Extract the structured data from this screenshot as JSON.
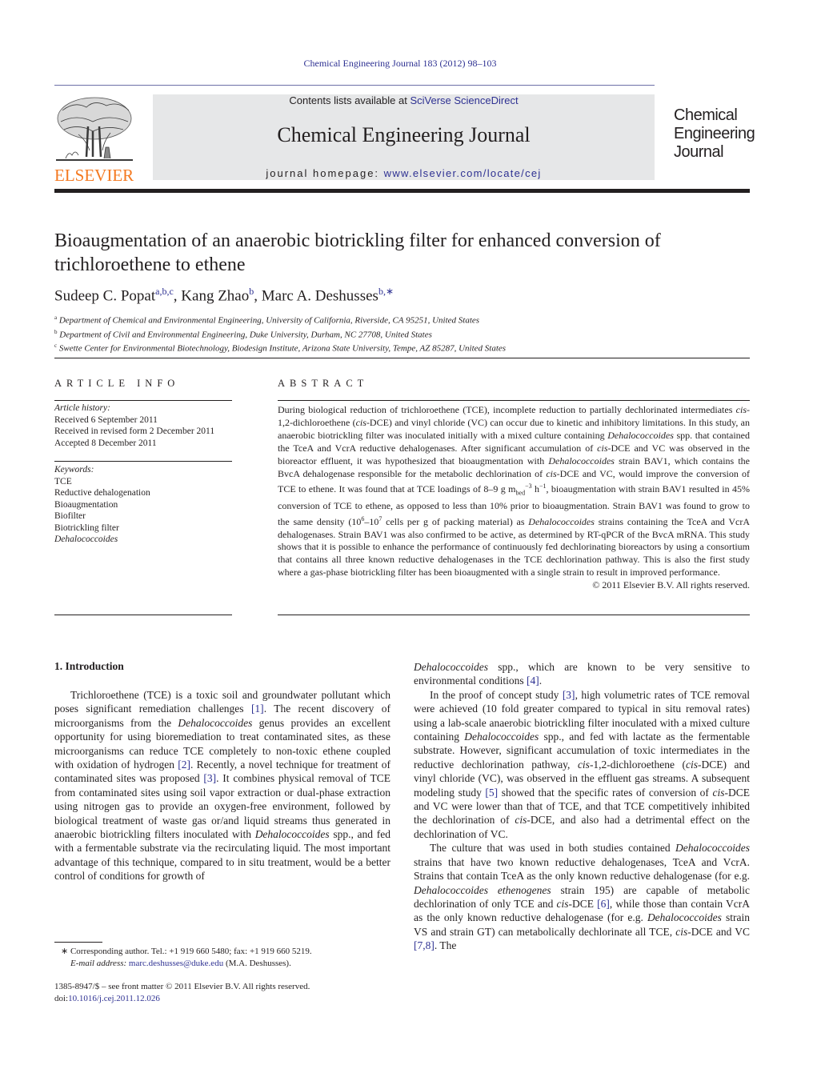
{
  "header": {
    "citation": "Chemical Engineering Journal 183 (2012) 98–103",
    "contents_prefix": "Contents lists available at ",
    "contents_link": "SciVerse ScienceDirect",
    "journal_title": "Chemical Engineering Journal",
    "homepage_prefix": "journal homepage: ",
    "homepage_link": "www.elsevier.com/locate/cej",
    "publisher_logo": "ELSEVIER",
    "cover_title": [
      "Chemical",
      "Engineering",
      "Journal"
    ]
  },
  "colors": {
    "link": "#2e3192",
    "elsevier_orange": "#f47920",
    "banner_bg": "#e6e7e8",
    "text": "#231f20"
  },
  "article": {
    "title_line1": "Bioaugmentation of an anaerobic biotrickling filter for enhanced conversion of",
    "title_line2": "trichloroethene to ethene",
    "authors": [
      {
        "name": "Sudeep C. Popat",
        "sup": "a,b,c",
        "sep": ", "
      },
      {
        "name": "Kang Zhao",
        "sup": "b",
        "sep": ", "
      },
      {
        "name": "Marc A. Deshusses",
        "sup": "b,∗",
        "sep": ""
      }
    ],
    "affiliations": [
      {
        "sup": "a",
        "text": "Department of Chemical and Environmental Engineering, University of California, Riverside, CA 95251, United States"
      },
      {
        "sup": "b",
        "text": "Department of Civil and Environmental Engineering, Duke University, Durham, NC 27708, United States"
      },
      {
        "sup": "c",
        "text": "Swette Center for Environmental Biotechnology, Biodesign Institute, Arizona State University, Tempe, AZ 85287, United States"
      }
    ]
  },
  "article_info": {
    "heading": "ARTICLE INFO",
    "history_label": "Article history:",
    "history": [
      "Received 6 September 2011",
      "Received in revised form 2 December 2011",
      "Accepted 8 December 2011"
    ],
    "keywords_label": "Keywords:",
    "keywords": [
      "TCE",
      "Reductive dehalogenation",
      "Bioaugmentation",
      "Biofilter",
      "Biotrickling filter",
      "Dehalococcoides"
    ]
  },
  "abstract": {
    "heading": "ABSTRACT",
    "s1": "During biological reduction of trichloroethene (TCE), incomplete reduction to partially dechlorinated intermediates ",
    "s1_cis1": "cis",
    "s1b": "-1,2-dichloroethene (",
    "s1_cis2": "cis",
    "s1c": "-DCE) and vinyl chloride (VC) can occur due to kinetic and inhibitory limitations. In this study, an anaerobic biotrickling filter was inoculated initially with a mixed culture containing ",
    "s1_dhc": "Dehalococcoides",
    "s1d": " spp. that contained the TceA and VcrA reductive dehalogenases. After significant accumulation of ",
    "s1_cis3": "cis",
    "s1e": "-DCE and VC was observed in the bioreactor effluent, it was hypothesized that bioaugmentation with ",
    "s1_dhc2": "Dehalococcoides",
    "s1f": " strain BAV1, which contains the BvcA dehalogenase responsible for the metabolic dechlorination of ",
    "s1_cis4": "cis",
    "s1g": "-DCE and VC, would improve the conversion of TCE to ethene. It was found that at TCE loadings of 8–9 g m",
    "s1_sub": "bed",
    "s1_sup1": "−3",
    "s1h": " h",
    "s1_sup2": "−1",
    "s1i": ", bioaugmentation with strain BAV1 resulted in 45% conversion of TCE to ethene, as opposed to less than 10% prior to bioaugmentation. Strain BAV1 was found to grow to the same density (10",
    "s1_sup3": "6",
    "s1j": "–10",
    "s1_sup4": "7",
    "s1k": " cells per g of packing material) as ",
    "s1_dhc3": "Dehalococcoides",
    "s1l": " strains containing the TceA and VcrA dehalogenases. Strain BAV1 was also confirmed to be active, as determined by RT-qPCR of the BvcA mRNA. This study shows that it is possible to enhance the performance of continuously fed dechlorinating bioreactors by using a consortium that contains all three known reductive dehalogenases in the TCE dechlorination pathway. This is also the first study where a gas-phase biotrickling filter has been bioaugmented with a single strain to result in improved performance.",
    "copyright": "© 2011 Elsevier B.V. All rights reserved."
  },
  "introduction": {
    "heading": "1.  Introduction",
    "p1": {
      "a": "Trichloroethene (TCE) is a toxic soil and groundwater pollutant which poses significant remediation challenges ",
      "r1": "[1]",
      "b": ". The recent discovery of microorganisms from the ",
      "dhc": "Dehalococcoides",
      "c": " genus provides an excellent opportunity for using bioremediation to treat contaminated sites, as these microorganisms can reduce TCE completely to non-toxic ethene coupled with oxidation of hydrogen ",
      "r2": "[2]",
      "d": ". Recently, a novel technique for treatment of contaminated sites was proposed ",
      "r3": "[3]",
      "e": ". It combines physical removal of TCE from contaminated sites using soil vapor extraction or dual-phase extraction using nitrogen gas to provide an oxygen-free environment, followed by biological treatment of waste gas or/and liquid streams thus generated in anaerobic biotrickling filters inoculated with ",
      "dhc2": "Dehalococcoides",
      "f": " spp., and fed with a fermentable substrate via the recirculating liquid. The most important advantage of this technique, compared to in situ treatment, would be a better control of conditions for growth of ",
      "dhc3": "Dehalococcoides",
      "g": " spp., which are known to be very sensitive to environmental conditions ",
      "r4": "[4]",
      "h": "."
    },
    "p2": {
      "a": "In the proof of concept study ",
      "r3": "[3]",
      "b": ", high volumetric rates of TCE removal were achieved (10 fold greater compared to typical in situ removal rates) using a lab-scale anaerobic biotrickling filter inoculated with a mixed culture containing ",
      "dhc": "Dehalococcoides",
      "c": " spp., and fed with lactate as the fermentable substrate. However, significant accumulation of toxic intermediates in the reductive dechlorination pathway, ",
      "cis1": "cis",
      "d": "-1,2-dichloroethene (",
      "cis2": "cis",
      "e": "-DCE) and vinyl chloride (VC), was observed in the effluent gas streams. A subsequent modeling study ",
      "r5": "[5]",
      "f": " showed that the specific rates of conversion of ",
      "cis3": "cis",
      "g": "-DCE and VC were lower than that of TCE, and that TCE competitively inhibited the dechlorination of ",
      "cis4": "cis",
      "h": "-DCE, and also had a detrimental effect on the dechlorination of VC."
    },
    "p3": {
      "a": "The culture that was used in both studies contained ",
      "dhc": "Dehalococcoides",
      "b": " strains that have two known reductive dehalogenases, TceA and VcrA. Strains that contain TceA as the only known reductive dehalogenase (for e.g. ",
      "dhe": "Dehalococcoides ethenogenes",
      "c": " strain 195) are capable of metabolic dechlorination of only TCE and ",
      "cis1": "cis",
      "d": "-DCE ",
      "r6": "[6]",
      "e": ", while those than contain VcrA as the only known reductive dehalogenase (for e.g. ",
      "dhc2": "Dehalococcoides",
      "f": " strain VS and strain GT) can metabolically dechlorinate all TCE, ",
      "cis2": "cis",
      "g": "-DCE and VC ",
      "r78": "[7,8]",
      "h": ". The"
    }
  },
  "footnote": {
    "mark": "∗",
    "text": " Corresponding author. Tel.: +1 919 660 5480; fax: +1 919 660 5219.",
    "email_label": "E-mail address: ",
    "email": "marc.deshusses@duke.edu",
    "email_suffix": " (M.A. Deshusses)."
  },
  "front_matter": {
    "issn_line": "1385-8947/$ – see front matter © 2011 Elsevier B.V. All rights reserved.",
    "doi_prefix": "doi:",
    "doi": "10.1016/j.cej.2011.12.026"
  }
}
